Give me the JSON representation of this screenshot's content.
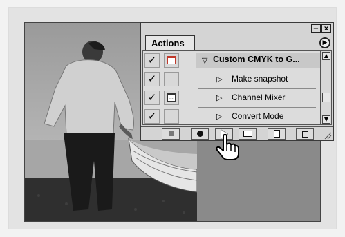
{
  "panel": {
    "minimize_label": "−",
    "close_label": "x",
    "tab_label": "Actions",
    "menu_icon": "arrow-right-icon",
    "actions": [
      {
        "label": "Custom CMYK to G...",
        "checked": "✓",
        "type": "set"
      },
      {
        "label": "Make snapshot",
        "checked": "✓",
        "type": "step"
      },
      {
        "label": "Channel Mixer",
        "checked": "✓",
        "type": "step"
      },
      {
        "label": "Convert Mode",
        "checked": "✓",
        "type": "step"
      }
    ],
    "toolbar_buttons": [
      "stop-icon",
      "record-icon",
      "play-icon",
      "folder-icon",
      "new-action-icon",
      "trash-icon"
    ]
  },
  "cursor": {
    "icon": "hand-pointer-icon"
  }
}
